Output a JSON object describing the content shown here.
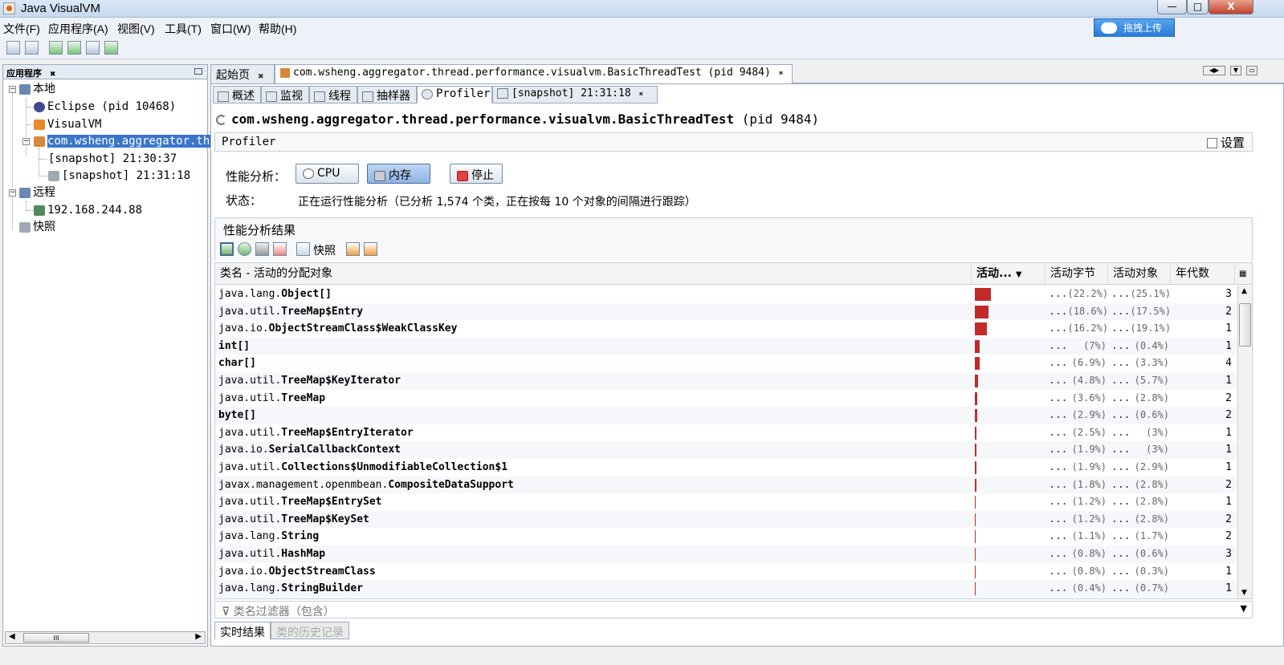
{
  "window": {
    "title": "Java VisualVM",
    "min": "—",
    "max": "□",
    "close": "X"
  },
  "upload_label": "拖拽上传",
  "menu": [
    "文件(F)",
    "应用程序(A)",
    "视图(V)",
    "工具(T)",
    "窗口(W)",
    "帮助(H)"
  ],
  "toolbar_icons": [
    "open-icon",
    "save-icon",
    "add-jmx-icon",
    "add-remote-icon",
    "snapshot-icon",
    "heap-dump-icon"
  ],
  "left_panel": {
    "title": "应用程序",
    "nodes": {
      "local": "本地",
      "eclipse": "Eclipse (pid 10468)",
      "visualvm": "VisualVM",
      "app": "com.wsheng.aggregator.thr",
      "snap1": "[snapshot] 21:30:37",
      "snap2": "[snapshot] 21:31:18",
      "remote": "远程",
      "ip": "192.168.244.88",
      "snapshots": "快照"
    }
  },
  "doc_tabs": {
    "start": "起始页",
    "app": "com.wsheng.aggregator.thread.performance.visualvm.BasicThreadTest (pid 9484)"
  },
  "sub_tabs": [
    "概述",
    "监视",
    "线程",
    "抽样器",
    "Profiler",
    "[snapshot] 21:31:18"
  ],
  "app_title": {
    "name": "com.wsheng.aggregator.thread.performance.visualvm.BasicThreadTest",
    "pid": "(pid 9484)"
  },
  "profiler": {
    "section": "Profiler",
    "settings": "设置",
    "analysis_label": "性能分析：",
    "btn_cpu": "CPU",
    "btn_memory": "内存",
    "btn_stop": "停止",
    "status_label": "状态：",
    "status_text": "正在运行性能分析（已分析 1,574 个类，正在按每 10 个对象的间隔进行跟踪）",
    "results_title": "性能分析结果",
    "snapshot_btn": "快照"
  },
  "table": {
    "columns": [
      "类名 - 活动的分配对象",
      "活动...",
      "活动字节",
      "活动对象",
      "年代数"
    ],
    "rows": [
      {
        "pre": "java.lang.",
        "name": "Object[]",
        "bar": 22.2,
        "bytes": "(22.2%)",
        "objs": "(25.1%)",
        "gen": "3"
      },
      {
        "pre": "java.util.",
        "name": "TreeMap$Entry",
        "bar": 18.6,
        "bytes": "(18.6%)",
        "objs": "(17.5%)",
        "gen": "2"
      },
      {
        "pre": "java.io.",
        "name": "ObjectStreamClass$WeakClassKey",
        "bar": 16.2,
        "bytes": "(16.2%)",
        "objs": "(19.1%)",
        "gen": "1"
      },
      {
        "pre": "",
        "name": "int[]",
        "bar": 7,
        "bytes": "(7%)",
        "objs": "(0.4%)",
        "gen": "1"
      },
      {
        "pre": "",
        "name": "char[]",
        "bar": 6.9,
        "bytes": "(6.9%)",
        "objs": "(3.3%)",
        "gen": "4"
      },
      {
        "pre": "java.util.",
        "name": "TreeMap$KeyIterator",
        "bar": 4.8,
        "bytes": "(4.8%)",
        "objs": "(5.7%)",
        "gen": "1"
      },
      {
        "pre": "java.util.",
        "name": "TreeMap",
        "bar": 3.6,
        "bytes": "(3.6%)",
        "objs": "(2.8%)",
        "gen": "2"
      },
      {
        "pre": "",
        "name": "byte[]",
        "bar": 2.9,
        "bytes": "(2.9%)",
        "objs": "(0.6%)",
        "gen": "2"
      },
      {
        "pre": "java.util.",
        "name": "TreeMap$EntryIterator",
        "bar": 2.5,
        "bytes": "(2.5%)",
        "objs": "(3%)",
        "gen": "1"
      },
      {
        "pre": "java.io.",
        "name": "SerialCallbackContext",
        "bar": 1.9,
        "bytes": "(1.9%)",
        "objs": "(3%)",
        "gen": "1"
      },
      {
        "pre": "java.util.",
        "name": "Collections$UnmodifiableCollection$1",
        "bar": 1.9,
        "bytes": "(1.9%)",
        "objs": "(2.9%)",
        "gen": "1"
      },
      {
        "pre": "javax.management.openmbean.",
        "name": "CompositeDataSupport",
        "bar": 1.8,
        "bytes": "(1.8%)",
        "objs": "(2.8%)",
        "gen": "2"
      },
      {
        "pre": "java.util.",
        "name": "TreeMap$EntrySet",
        "bar": 1.2,
        "bytes": "(1.2%)",
        "objs": "(2.8%)",
        "gen": "1"
      },
      {
        "pre": "java.util.",
        "name": "TreeMap$KeySet",
        "bar": 1.2,
        "bytes": "(1.2%)",
        "objs": "(2.8%)",
        "gen": "2"
      },
      {
        "pre": "java.lang.",
        "name": "String",
        "bar": 1.1,
        "bytes": "(1.1%)",
        "objs": "(1.7%)",
        "gen": "2"
      },
      {
        "pre": "java.util.",
        "name": "HashMap",
        "bar": 0.8,
        "bytes": "(0.8%)",
        "objs": "(0.6%)",
        "gen": "3"
      },
      {
        "pre": "java.io.",
        "name": "ObjectStreamClass",
        "bar": 0.8,
        "bytes": "(0.8%)",
        "objs": "(0.3%)",
        "gen": "1"
      },
      {
        "pre": "java.lang.",
        "name": "StringBuilder",
        "bar": 0.4,
        "bytes": "(0.4%)",
        "objs": "(0.7%)",
        "gen": "1"
      }
    ]
  },
  "filter_placeholder": "类名过滤器（包含）",
  "bottom_tabs": [
    "实时结果",
    "类的历史记录"
  ],
  "colors": {
    "bar": "#c22a2a",
    "selection": "#3a76cc"
  }
}
